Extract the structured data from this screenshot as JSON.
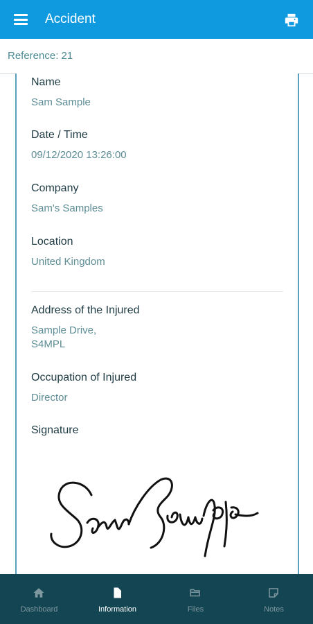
{
  "app_bar": {
    "title": "Accident",
    "menu_icon": "menu-icon",
    "print_icon": "printer-icon"
  },
  "reference": {
    "text": "Reference: 21"
  },
  "fields": [
    {
      "label": "Name",
      "value": "Sam Sample"
    },
    {
      "label": "Date / Time",
      "value": "09/12/2020 13:26:00"
    },
    {
      "label": "Company",
      "value": "Sam's Samples"
    },
    {
      "label": "Location",
      "value": "United Kingdom"
    },
    {
      "label": "Address of the Injured",
      "value_line1": "Sample Drive,",
      "value_line2": "S4MPL"
    },
    {
      "label": "Occupation of Injured",
      "value": "Director"
    },
    {
      "label": "Signature"
    }
  ],
  "bottom_nav": {
    "items": [
      {
        "label": "Dashboard",
        "icon": "home-icon",
        "active": false
      },
      {
        "label": "Information",
        "icon": "document-icon",
        "active": true
      },
      {
        "label": "Files",
        "icon": "folder-icon",
        "active": false
      },
      {
        "label": "Notes",
        "icon": "note-icon",
        "active": false
      }
    ]
  },
  "colors": {
    "app_bar": "#0f9ae0",
    "bottom_nav": "#144552",
    "card_border": "#5a9fc0",
    "label_text": "#1f3b44",
    "value_text": "#5d8d95"
  }
}
